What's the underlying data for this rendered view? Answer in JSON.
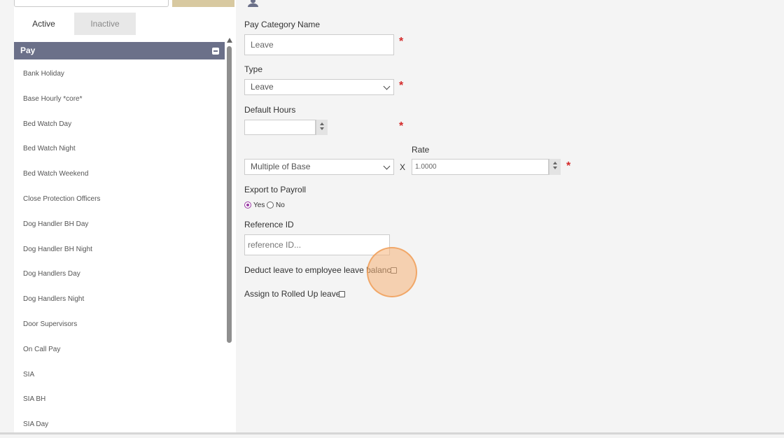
{
  "tabs": {
    "active": "Active",
    "inactive": "Inactive"
  },
  "group": {
    "title": "Pay"
  },
  "categories": [
    "Bank Holiday",
    "Base Hourly *core*",
    "Bed Watch Day",
    "Bed Watch Night",
    "Bed Watch Weekend",
    "Close Protection Officers",
    "Dog Handler BH Day",
    "Dog Handler BH Night",
    "Dog Handlers Day",
    "Dog Handlers Night",
    "Door Supervisors",
    "On Call Pay",
    "SIA",
    "SIA BH",
    "SIA Day"
  ],
  "form": {
    "pay_category_label": "Pay Category Name",
    "pay_category_value": "Leave",
    "type_label": "Type",
    "type_value": "Leave",
    "default_hours_label": "Default Hours",
    "default_hours_value": "",
    "rate_label": "Rate",
    "rate_basis_value": "Multiple of Base",
    "multiply_symbol": "X",
    "rate_value": "1.0000",
    "export_label": "Export to Payroll",
    "export_yes": "Yes",
    "export_no": "No",
    "export_selected": "Yes",
    "reference_label": "Reference ID",
    "reference_placeholder": "reference ID...",
    "deduct_label": "Deduct leave to employee leave balance",
    "deduct_checked": false,
    "rolled_up_label": "Assign to Rolled Up leave",
    "rolled_up_checked": false,
    "required_mark": "*"
  },
  "colors": {
    "group_header": "#6b7089",
    "required": "#d42a2a",
    "radio_accent": "#9a3aa5",
    "top_button": "#d8c9a0"
  }
}
